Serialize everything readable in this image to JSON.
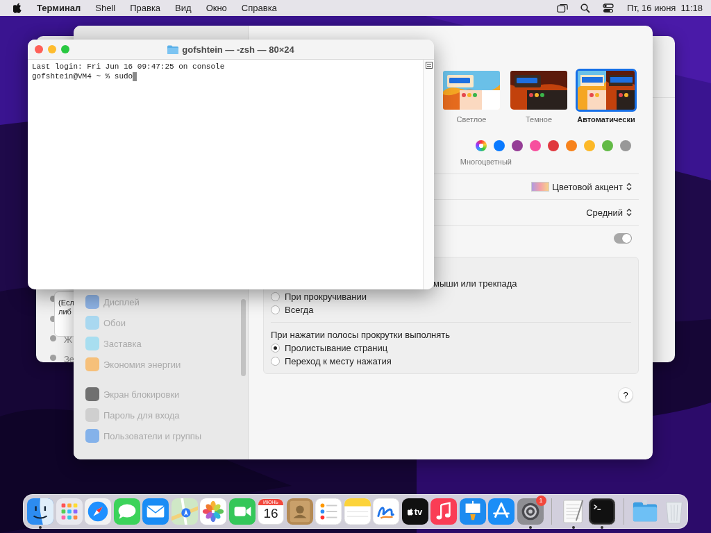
{
  "menu_bar": {
    "app_name": "Терминал",
    "menus": [
      "Shell",
      "Правка",
      "Вид",
      "Окно",
      "Справка"
    ],
    "date": "Пт, 16 июня",
    "time": "11:18"
  },
  "back_window": {
    "sheet_lines": [
      "(Есл",
      "либ"
    ],
    "list_items": [
      "Ж",
      "Зе"
    ]
  },
  "settings": {
    "sidebar": {
      "groups": [
        {
          "items": [
            {
              "label": "Дисплей",
              "kind": "display"
            },
            {
              "label": "Обои",
              "kind": "wallpaper"
            },
            {
              "label": "Заставка",
              "kind": "screensaver"
            },
            {
              "label": "Экономия энергии",
              "kind": "energy"
            }
          ]
        },
        {
          "items": [
            {
              "label": "Экран блокировки",
              "kind": "lock"
            },
            {
              "label": "Пароль для входа",
              "kind": "password"
            },
            {
              "label": "Пользователи и группы",
              "kind": "users"
            }
          ]
        }
      ]
    },
    "appearance": [
      {
        "label": "Светлое",
        "kind": "light",
        "selected": false
      },
      {
        "label": "Темное",
        "kind": "dark",
        "selected": false
      },
      {
        "label": "Автоматически",
        "kind": "auto",
        "selected": true
      }
    ],
    "accent_colors": [
      {
        "kind": "multicolor",
        "selected": true
      },
      {
        "kind": "solid",
        "color": "#0a7aff",
        "selected": false
      },
      {
        "kind": "solid",
        "color": "#953d96",
        "selected": false
      },
      {
        "kind": "solid",
        "color": "#f74f9e",
        "selected": false
      },
      {
        "kind": "solid",
        "color": "#e0383e",
        "selected": false
      },
      {
        "kind": "solid",
        "color": "#f7821b",
        "selected": false
      },
      {
        "kind": "solid",
        "color": "#fcb827",
        "selected": false
      },
      {
        "kind": "solid",
        "color": "#62ba46",
        "selected": false
      },
      {
        "kind": "solid",
        "color": "#989898",
        "selected": false
      }
    ],
    "accent_label": "Многоцветный",
    "highlight_color": "Цветовой акцент",
    "icon_size": "Средний",
    "toggle": {
      "on": true
    },
    "scroll_section": {
      "line": "мыши или трекпада",
      "show_options": [
        {
          "label": "При прокручивании",
          "selected": false
        },
        {
          "label": "Всегда",
          "selected": false
        }
      ],
      "click_heading": "При нажатии полосы прокрутки выполнять",
      "click_options": [
        {
          "label": "Пролистывание страниц",
          "selected": true
        },
        {
          "label": "Переход к месту нажатия",
          "selected": false
        }
      ]
    },
    "help": "?"
  },
  "terminal": {
    "title": "gofshtein — -zsh — 80×24",
    "lines": [
      "Last login: Fri Jun 16 09:47:25 on console",
      "gofshtein@VM4 ~ % sudo"
    ]
  },
  "dock": {
    "items": [
      {
        "kind": "finder",
        "running": true
      },
      {
        "kind": "launchpad"
      },
      {
        "kind": "safari"
      },
      {
        "kind": "messages"
      },
      {
        "kind": "mail"
      },
      {
        "kind": "maps"
      },
      {
        "kind": "photos"
      },
      {
        "kind": "facetime"
      },
      {
        "kind": "calendar",
        "month": "ИЮНЬ",
        "day": "16"
      },
      {
        "kind": "contacts"
      },
      {
        "kind": "reminders"
      },
      {
        "kind": "notes"
      },
      {
        "kind": "freeform"
      },
      {
        "kind": "tv",
        "label": "tv"
      },
      {
        "kind": "music"
      },
      {
        "kind": "keynote"
      },
      {
        "kind": "appstore"
      },
      {
        "kind": "settings",
        "badge": "1",
        "running": true
      },
      {
        "kind": "divider"
      },
      {
        "kind": "textedit",
        "running": true
      },
      {
        "kind": "terminal",
        "running": true
      },
      {
        "kind": "divider"
      },
      {
        "kind": "folder"
      },
      {
        "kind": "trash"
      }
    ]
  }
}
